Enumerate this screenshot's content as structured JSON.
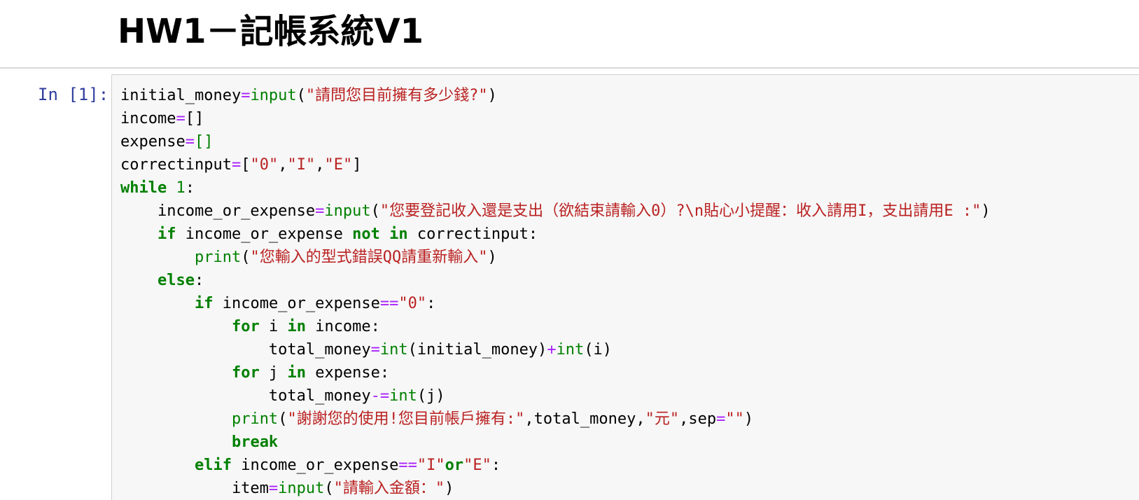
{
  "markdown": {
    "title": "HW1－記帳系統V1"
  },
  "code_cell": {
    "prompt": "In [1]:",
    "lines": [
      [
        {
          "t": "initial_money",
          "c": "p"
        },
        {
          "t": "=",
          "c": "op"
        },
        {
          "t": "input",
          "c": "fn"
        },
        {
          "t": "(",
          "c": "p"
        },
        {
          "t": "\"請問您目前擁有多少錢?\"",
          "c": "str"
        },
        {
          "t": ")",
          "c": "p"
        }
      ],
      [
        {
          "t": "income",
          "c": "p"
        },
        {
          "t": "=",
          "c": "op"
        },
        {
          "t": "[]",
          "c": "br"
        }
      ],
      [
        {
          "t": "expense",
          "c": "p"
        },
        {
          "t": "=",
          "c": "op"
        },
        {
          "t": "[]",
          "c": "brc"
        }
      ],
      [
        {
          "t": "correctinput",
          "c": "p"
        },
        {
          "t": "=",
          "c": "op"
        },
        {
          "t": "[",
          "c": "p"
        },
        {
          "t": "\"0\"",
          "c": "str"
        },
        {
          "t": ",",
          "c": "p"
        },
        {
          "t": "\"I\"",
          "c": "str"
        },
        {
          "t": ",",
          "c": "p"
        },
        {
          "t": "\"E\"",
          "c": "str"
        },
        {
          "t": "]",
          "c": "p"
        }
      ],
      [
        {
          "t": "while",
          "c": "kw"
        },
        {
          "t": " ",
          "c": "p"
        },
        {
          "t": "1",
          "c": "num"
        },
        {
          "t": ":",
          "c": "p"
        }
      ],
      [
        {
          "t": "    income_or_expense",
          "c": "p"
        },
        {
          "t": "=",
          "c": "op"
        },
        {
          "t": "input",
          "c": "fn"
        },
        {
          "t": "(",
          "c": "p"
        },
        {
          "t": "\"您要登記收入還是支出（欲結束請輸入0）?\\n貼心小提醒：收入請用I，支出請用E :\"",
          "c": "str"
        },
        {
          "t": ")",
          "c": "p"
        }
      ],
      [
        {
          "t": "    ",
          "c": "p"
        },
        {
          "t": "if",
          "c": "kw"
        },
        {
          "t": " income_or_expense ",
          "c": "p"
        },
        {
          "t": "not",
          "c": "kw"
        },
        {
          "t": " ",
          "c": "p"
        },
        {
          "t": "in",
          "c": "kw"
        },
        {
          "t": " correctinput:",
          "c": "p"
        }
      ],
      [
        {
          "t": "        ",
          "c": "p"
        },
        {
          "t": "print",
          "c": "fn"
        },
        {
          "t": "(",
          "c": "p"
        },
        {
          "t": "\"您輸入的型式錯誤QQ請重新輸入\"",
          "c": "str"
        },
        {
          "t": ")",
          "c": "p"
        }
      ],
      [
        {
          "t": "    ",
          "c": "p"
        },
        {
          "t": "else",
          "c": "kw"
        },
        {
          "t": ":",
          "c": "p"
        }
      ],
      [
        {
          "t": "        ",
          "c": "p"
        },
        {
          "t": "if",
          "c": "kw"
        },
        {
          "t": " income_or_expense",
          "c": "p"
        },
        {
          "t": "==",
          "c": "op"
        },
        {
          "t": "\"0\"",
          "c": "str"
        },
        {
          "t": ":",
          "c": "p"
        }
      ],
      [
        {
          "t": "            ",
          "c": "p"
        },
        {
          "t": "for",
          "c": "kw"
        },
        {
          "t": " i ",
          "c": "p"
        },
        {
          "t": "in",
          "c": "kw"
        },
        {
          "t": " income:",
          "c": "p"
        }
      ],
      [
        {
          "t": "                total_money",
          "c": "p"
        },
        {
          "t": "=",
          "c": "op"
        },
        {
          "t": "int",
          "c": "fn"
        },
        {
          "t": "(initial_money)",
          "c": "p"
        },
        {
          "t": "+",
          "c": "op"
        },
        {
          "t": "int",
          "c": "fn"
        },
        {
          "t": "(i)",
          "c": "p"
        }
      ],
      [
        {
          "t": "            ",
          "c": "p"
        },
        {
          "t": "for",
          "c": "kw"
        },
        {
          "t": " j ",
          "c": "p"
        },
        {
          "t": "in",
          "c": "kw"
        },
        {
          "t": " expense:",
          "c": "p"
        }
      ],
      [
        {
          "t": "                total_money",
          "c": "p"
        },
        {
          "t": "-=",
          "c": "op"
        },
        {
          "t": "int",
          "c": "fn"
        },
        {
          "t": "(j)",
          "c": "p"
        }
      ],
      [
        {
          "t": "            ",
          "c": "p"
        },
        {
          "t": "print",
          "c": "fn"
        },
        {
          "t": "(",
          "c": "p"
        },
        {
          "t": "\"謝謝您的使用!您目前帳戶擁有:\"",
          "c": "str"
        },
        {
          "t": ",total_money,",
          "c": "p"
        },
        {
          "t": "\"元\"",
          "c": "str"
        },
        {
          "t": ",sep",
          "c": "p"
        },
        {
          "t": "=",
          "c": "op"
        },
        {
          "t": "\"\"",
          "c": "str"
        },
        {
          "t": ")",
          "c": "p"
        }
      ],
      [
        {
          "t": "            ",
          "c": "p"
        },
        {
          "t": "break",
          "c": "kw"
        }
      ],
      [
        {
          "t": "        ",
          "c": "p"
        },
        {
          "t": "elif",
          "c": "kw"
        },
        {
          "t": " income_or_expense",
          "c": "p"
        },
        {
          "t": "==",
          "c": "op"
        },
        {
          "t": "\"I\"",
          "c": "str"
        },
        {
          "t": "or",
          "c": "kw"
        },
        {
          "t": "\"E\"",
          "c": "str"
        },
        {
          "t": ":",
          "c": "p"
        }
      ],
      [
        {
          "t": "            item",
          "c": "p"
        },
        {
          "t": "=",
          "c": "op"
        },
        {
          "t": "input",
          "c": "fn"
        },
        {
          "t": "(",
          "c": "p"
        },
        {
          "t": "\"請輸入金額：\"",
          "c": "str"
        },
        {
          "t": ")",
          "c": "p"
        }
      ]
    ]
  },
  "colors": {
    "keyword": "#008000",
    "builtin": "#008000",
    "operator": "#aa22ff",
    "string": "#ba2121",
    "prompt": "#303f9f",
    "cell_background": "#f7f7f7",
    "cell_border": "#cfcfcf"
  }
}
